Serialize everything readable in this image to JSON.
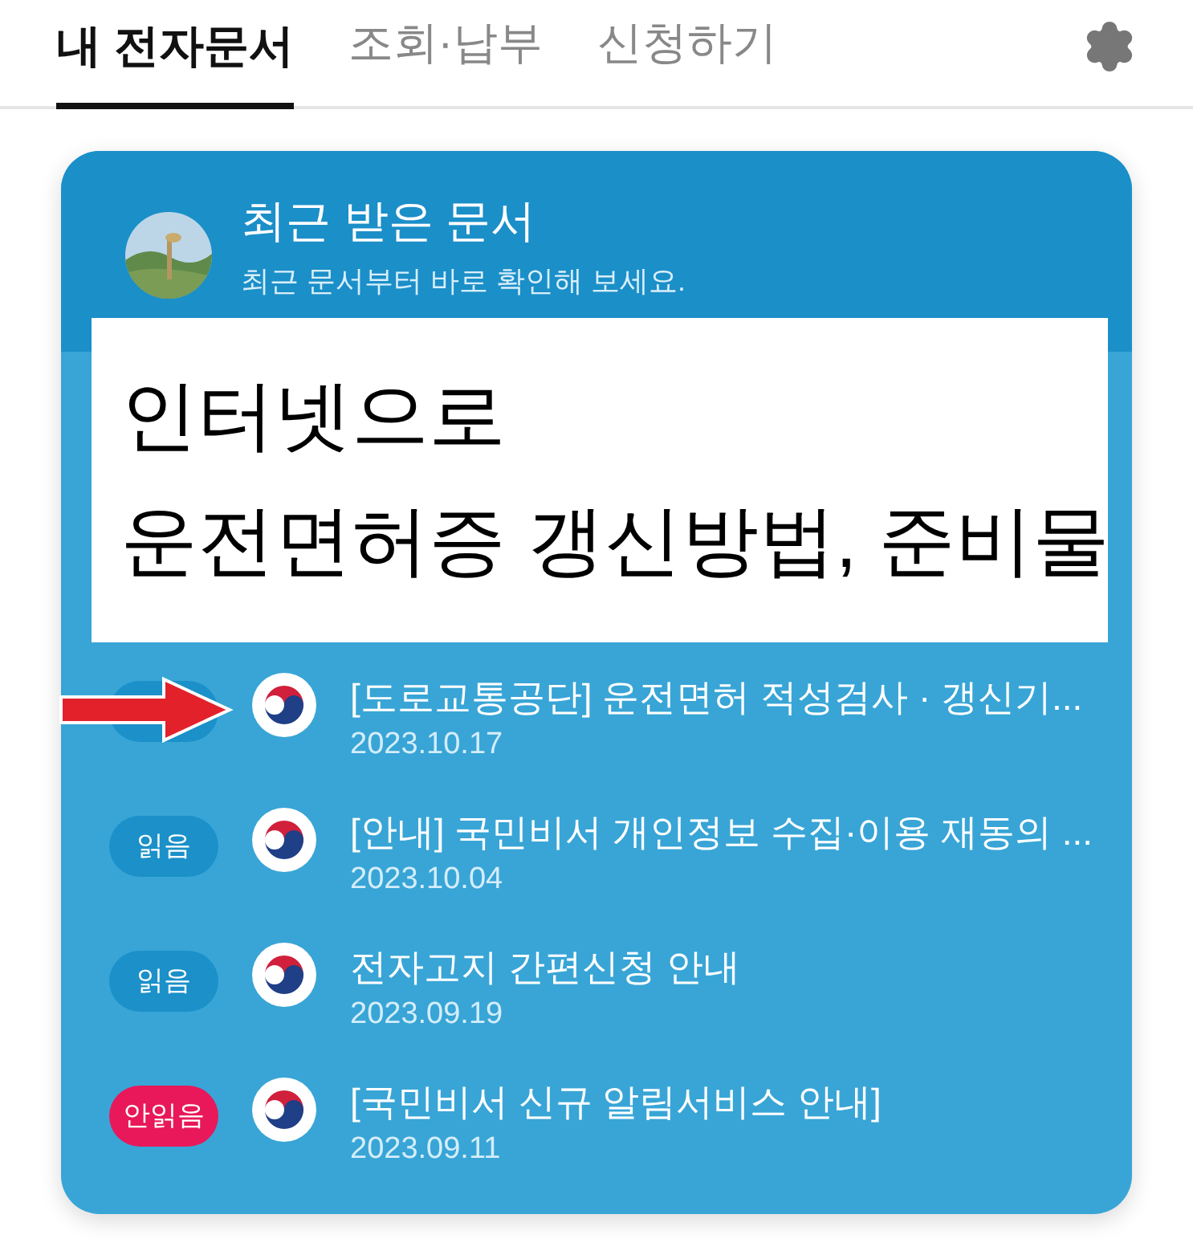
{
  "tabs": [
    {
      "label": "내 전자문서",
      "selected": true
    },
    {
      "label": "조회·납부",
      "selected": false
    },
    {
      "label": "신청하기",
      "selected": false
    }
  ],
  "card": {
    "title": "최근 받은 문서",
    "subtitle": "최근 문서부터 바로 확인해 보세요."
  },
  "overlay_caption": {
    "lines": [
      "인터넷으로",
      "운전면허증 갱신방법, 준비물"
    ]
  },
  "documents": [
    {
      "read": true,
      "title": "[도로교통공단] 운전면허 적성검사 · 갱신기...",
      "date": "2023.10.17"
    },
    {
      "read": true,
      "badge": "읽음",
      "title": "[안내] 국민비서 개인정보 수집·이용 재동의 ...",
      "date": "2023.10.04"
    },
    {
      "read": true,
      "badge": "읽음",
      "title": "전자고지 간편신청 안내",
      "date": "2023.09.19"
    },
    {
      "read": false,
      "badge": "안읽음",
      "title": "[국민비서 신규 알림서비스 안내]",
      "date": "2023.09.11"
    }
  ]
}
